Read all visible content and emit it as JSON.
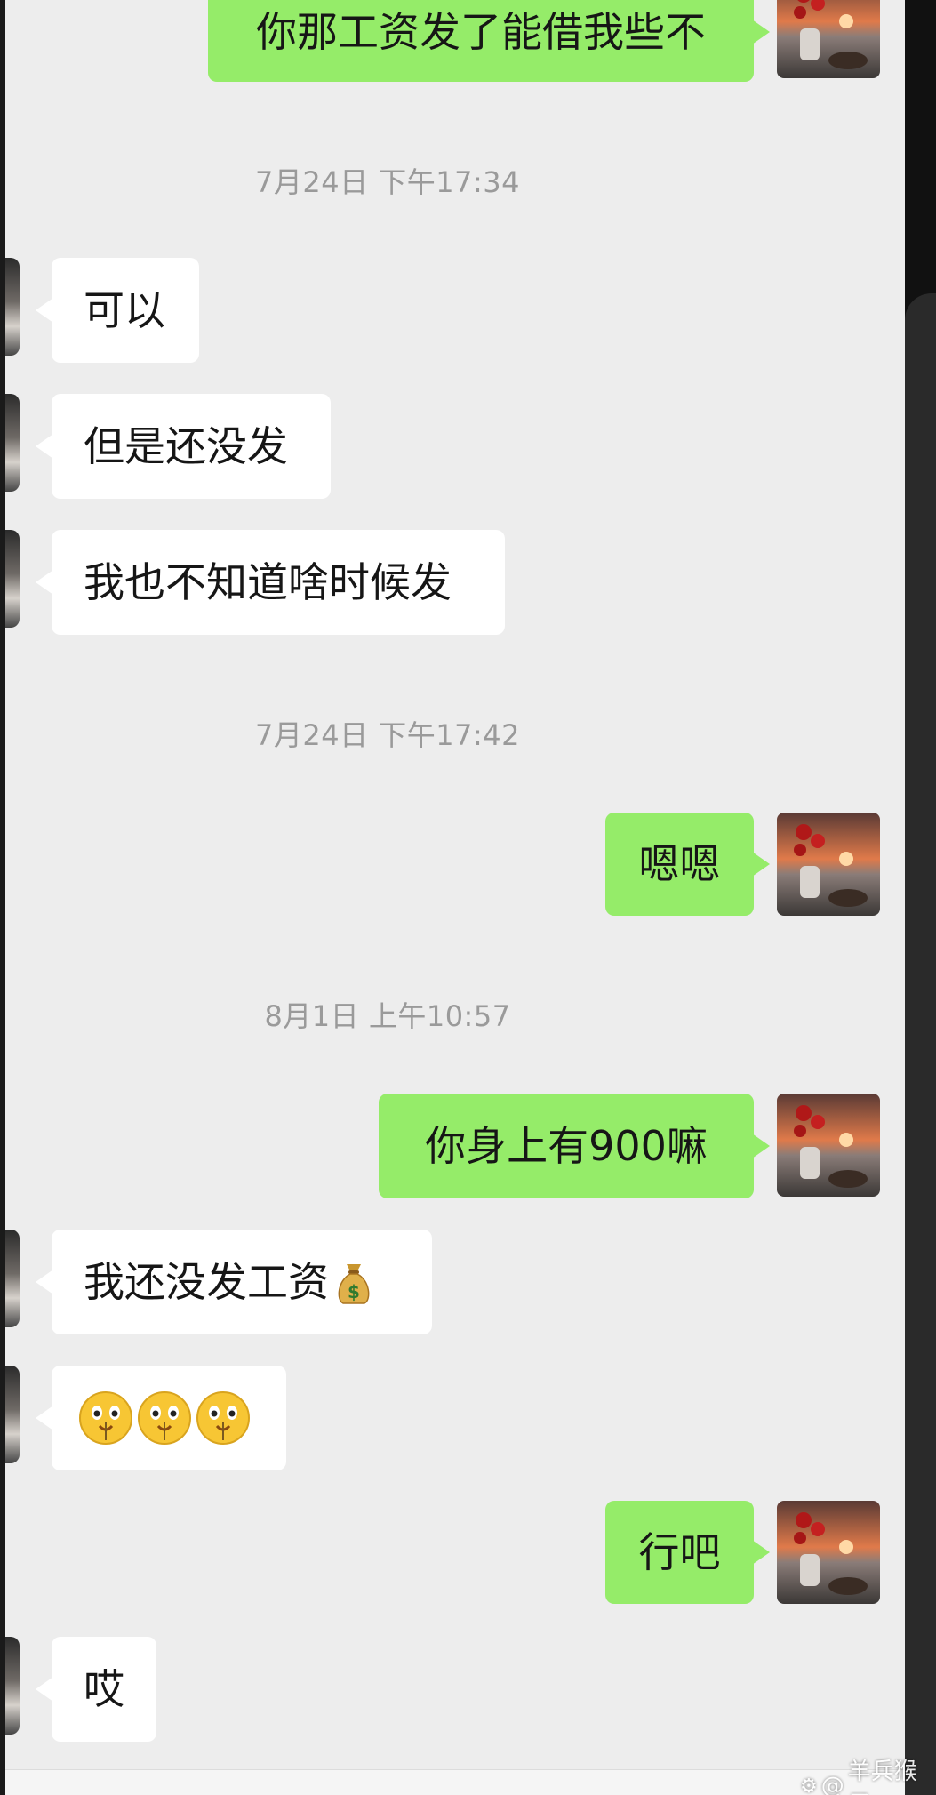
{
  "chat": {
    "messages": [
      {
        "side": "out",
        "text": "你那工资发了能借我些不"
      },
      {
        "side": "time",
        "text": "7月24日 下午17:34"
      },
      {
        "side": "in",
        "text": "可以"
      },
      {
        "side": "in",
        "text": "但是还没发"
      },
      {
        "side": "in",
        "text": "我也不知道啥时候发"
      },
      {
        "side": "time",
        "text": "7月24日 下午17:42"
      },
      {
        "side": "out",
        "text": "嗯嗯"
      },
      {
        "side": "time",
        "text": "8月1日 上午10:57"
      },
      {
        "side": "out",
        "text": "你身上有900嘛"
      },
      {
        "side": "in",
        "text": "我还没发工资",
        "emoji": "money-bag-icon"
      },
      {
        "side": "in",
        "text": "",
        "emoji": "money-mouth-face-icon",
        "emoji_count": 3
      },
      {
        "side": "out",
        "text": "行吧"
      },
      {
        "side": "in",
        "text": "哎"
      }
    ]
  },
  "watermark": {
    "symbol": "@",
    "text": "羊兵猴子"
  },
  "colors": {
    "outgoing_bubble": "#95ec69",
    "incoming_bubble": "#ffffff",
    "background": "#ededed",
    "timestamp": "#9a9a9a"
  }
}
